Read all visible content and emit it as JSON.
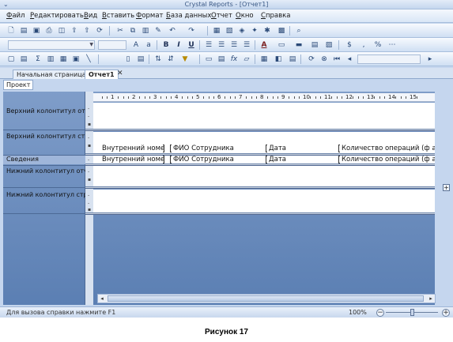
{
  "window": {
    "title": "Crystal Reports - [Отчет1]"
  },
  "menu": [
    "Файл",
    "Редактировать",
    "Вид",
    "Вставить",
    "Формат",
    "База данных",
    "Отчет",
    "Окно",
    "Справка"
  ],
  "toolbar": {
    "font_size_value": "",
    "bold_label": "B",
    "italic_label": "I",
    "underline_label": "U",
    "currency_label": "$",
    "font_color_label": "A",
    "sum_label": "Σ",
    "formula_label": "fx"
  },
  "tabs": [
    {
      "label": "Начальная страница"
    },
    {
      "label": "Отчет1"
    }
  ],
  "subtab": "Проект",
  "sections": {
    "report_header": "Верхний колонтитул отчет",
    "page_header": "Верхний колонтитул стран",
    "details": "Сведения",
    "report_footer": "Нижний колонтитул отчет-",
    "page_footer": "Нижний колонтитул стран"
  },
  "ruler_numbers": [
    "1",
    "2",
    "3",
    "4",
    "5",
    "6",
    "7",
    "8",
    "9",
    "10",
    "11",
    "12",
    "13",
    "14",
    "15"
  ],
  "header_fields": [
    "Внутренний номе",
    "ФИО Сотрудника",
    "Дата",
    "Количество операций (ф а"
  ],
  "detail_fields": [
    "Внутренний номе",
    "ФИО Сотрудника",
    "Дата",
    "Количество операций (ф а"
  ],
  "status": {
    "hint": "Для вызова справки нажмите F1",
    "zoom": "100%"
  },
  "caption": "Рисунок 17",
  "icons": [
    "new-icon",
    "open-icon",
    "save-icon",
    "print-icon",
    "preview-icon",
    "export-icon",
    "cut-icon",
    "copy-icon",
    "paste-icon",
    "undo-icon",
    "redo-icon",
    "search-icon",
    "close-tab-icon"
  ]
}
